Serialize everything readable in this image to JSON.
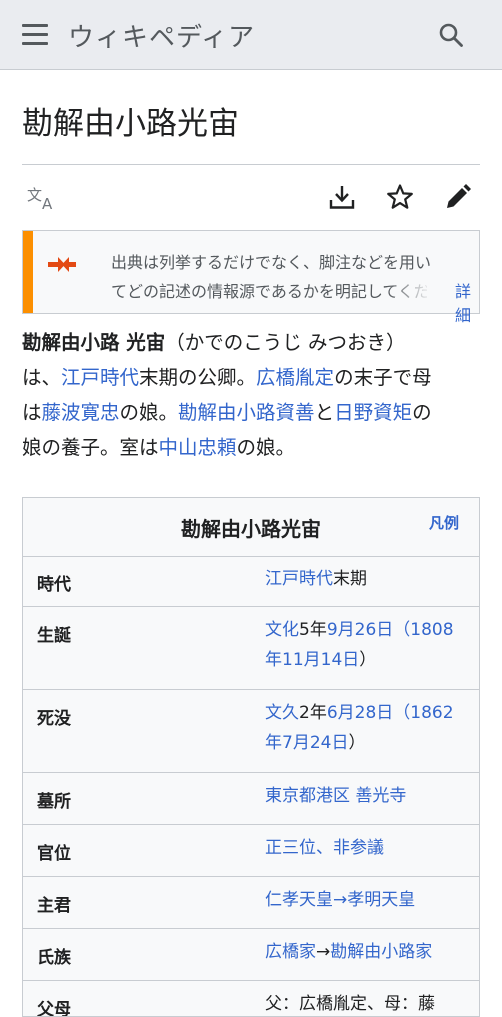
{
  "header": {
    "wordmark": "ウィキペディア",
    "menu_icon": "hamburger-menu-icon",
    "search_icon": "search-icon"
  },
  "page": {
    "title": "勘解由小路光宙"
  },
  "actions": {
    "language_icon": "language-translate-icon",
    "download_icon": "download-icon",
    "watch_icon": "star-icon",
    "edit_icon": "pencil-edit-icon"
  },
  "notice": {
    "line1": "出典は列挙するだけでなく、脚注などを用い",
    "line2": "てどの記述の情報源であるかを明記してください。",
    "more": "詳細",
    "accent_color": "#fc8f00",
    "icon": "merge-arrows-icon"
  },
  "intro": {
    "l1_bold": "勘解由小路 光宙",
    "l1_rest": "（かでのこうじ みつおき）",
    "l2_a": "は、",
    "l2_link1": "江戸時代",
    "l2_b": "末期の公卿。",
    "l2_link2": "広橋胤定",
    "l2_c": "の末子で母",
    "l3_a": "は",
    "l3_link1": "藤波寛忠",
    "l3_b": "の娘。",
    "l3_link2": "勘解由小路資善",
    "l3_c": "と",
    "l3_link3": "日野資矩",
    "l3_d": "の",
    "l4_a": "娘の養子。室は",
    "l4_link1": "中山忠頼",
    "l4_b": "の娘。"
  },
  "infobox": {
    "title": "勘解由小路光宙",
    "legend": "凡例",
    "rows": [
      {
        "label": "時代",
        "v1_link": "江戸時代",
        "v1_text": "末期"
      },
      {
        "label": "生誕",
        "l1_a": "文化",
        "l1_b": "5年",
        "l1_c": "9月26日",
        "l1_d": "（",
        "l1_e": "1808",
        "l2_a": "年11月14日",
        "l2_b": "）"
      },
      {
        "label": "死没",
        "l1_a": "文久",
        "l1_b": "2年",
        "l1_c": "6月28日",
        "l1_d": "（",
        "l1_e": "1862",
        "l2_a": "年7月24日",
        "l2_b": "）"
      },
      {
        "label": "墓所",
        "v1_link": "東京都港区 善光寺"
      },
      {
        "label": "官位",
        "v1_link": "正三位",
        "v1_sep": "、",
        "v1_link2": "非参議"
      },
      {
        "label": "主君",
        "v1_link": "仁孝天皇",
        "v1_sep": "→",
        "v1_link2": "孝明天皇"
      },
      {
        "label": "氏族",
        "v1_link": "広橋家",
        "v1_sep": "→",
        "v1_link2": "勘解由小路家"
      }
    ],
    "partial_row_label": "父母",
    "partial_row_text": "父：広橋胤定、母：藤"
  },
  "colors": {
    "link": "#3366cc",
    "header_bg": "#eaecf0",
    "infobox_bg": "#f8f9fa"
  }
}
